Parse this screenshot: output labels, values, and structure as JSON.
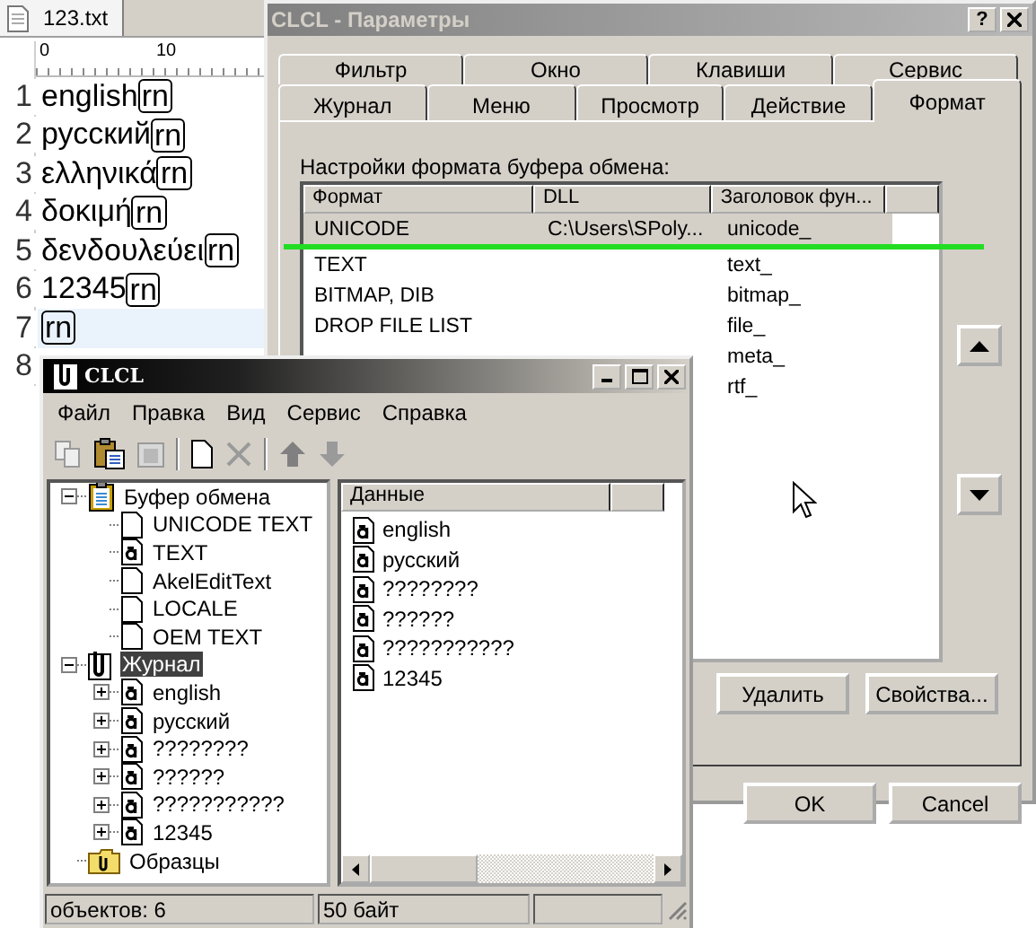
{
  "editor": {
    "tab": "123.txt",
    "ruler": [
      "0",
      "10"
    ],
    "lines": [
      {
        "number": "1",
        "text": "english",
        "eol": "rn",
        "current": false
      },
      {
        "number": "2",
        "text": "русский",
        "eol": "rn",
        "current": false
      },
      {
        "number": "3",
        "text": "ελληνικά",
        "eol": "rn",
        "current": false
      },
      {
        "number": "4",
        "text": "δοκιμή",
        "eol": "rn",
        "current": false
      },
      {
        "number": "5",
        "text": "δενδουλεύει",
        "eol": "rn",
        "current": false
      },
      {
        "number": "6",
        "text": "12345",
        "eol": "rn",
        "current": false
      },
      {
        "number": "7",
        "eol": "rn",
        "current": true
      },
      {
        "number": "8",
        "current": false
      }
    ]
  },
  "options_dialog": {
    "title": "CLCL - Параметры",
    "help_button": "?",
    "tabs_back": [
      {
        "label": "Фильтр",
        "selected": false
      },
      {
        "label": "Окно",
        "selected": false
      },
      {
        "label": "Клавиши",
        "selected": false
      },
      {
        "label": "Сервис",
        "selected": false
      }
    ],
    "tabs_front": [
      {
        "label": "Журнал",
        "selected": false
      },
      {
        "label": "Меню",
        "selected": false
      },
      {
        "label": "Просмотр",
        "selected": false
      },
      {
        "label": "Действие",
        "selected": false
      },
      {
        "label": "Формат",
        "selected": true
      }
    ],
    "section_label": "Настройки формата буфера обмена:",
    "columns": [
      "Формат",
      "DLL",
      "Заголовок фун..."
    ],
    "rows": [
      {
        "format": "UNICODE",
        "dll": "C:\\Users\\SPoly...",
        "header": "unicode_",
        "selected": true
      },
      {
        "format": "TEXT",
        "header": "text_",
        "selected": false
      },
      {
        "format": "BITMAP, DIB",
        "header": "bitmap_",
        "selected": false
      },
      {
        "format": "DROP FILE LIST",
        "header": "file_",
        "selected": false
      },
      {
        "header": "meta_",
        "selected": false
      },
      {
        "header": "rtf_",
        "selected": false
      }
    ],
    "buttons": [
      "Удалить",
      "Свойства..."
    ],
    "dialog_buttons": [
      "OK",
      "Cancel"
    ]
  },
  "clcl": {
    "title": "CLCL",
    "menu": [
      "Файл",
      "Правка",
      "Вид",
      "Сервис",
      "Справка"
    ],
    "toolbar": [
      {
        "kind": "copy",
        "disabled": true
      },
      {
        "kind": "paste",
        "disabled": false
      },
      {
        "kind": "clear",
        "disabled": true
      },
      {
        "kind": "separator"
      },
      {
        "kind": "new",
        "disabled": false
      },
      {
        "kind": "delete",
        "disabled": true
      },
      {
        "kind": "separator"
      },
      {
        "kind": "up",
        "disabled": false
      },
      {
        "kind": "down",
        "disabled": true
      }
    ],
    "tree": [
      {
        "label": "Буфер обмена",
        "kind": "clipboard",
        "expanded": true,
        "selected": false,
        "children": [
          {
            "label": "UNICODE TEXT",
            "kind": "blank",
            "selected": false
          },
          {
            "label": "TEXT",
            "kind": "text",
            "selected": false
          },
          {
            "label": "AkelEditText",
            "kind": "blank",
            "selected": false
          },
          {
            "label": "LOCALE",
            "kind": "blank",
            "selected": false
          },
          {
            "label": "OEM TEXT",
            "kind": "blank",
            "selected": false
          }
        ]
      },
      {
        "label": "Журнал",
        "kind": "history",
        "expanded": true,
        "selected": true,
        "children": [
          {
            "label": "english",
            "kind": "text",
            "expanded": false,
            "selected": false
          },
          {
            "label": "русский",
            "kind": "text",
            "expanded": false,
            "selected": false
          },
          {
            "label": "????????",
            "kind": "text",
            "expanded": false,
            "selected": false
          },
          {
            "label": "??????",
            "kind": "text",
            "expanded": false,
            "selected": false
          },
          {
            "label": "???????????",
            "kind": "text",
            "expanded": false,
            "selected": false
          },
          {
            "label": "12345",
            "kind": "text",
            "expanded": false,
            "selected": false
          }
        ]
      },
      {
        "label": "Образцы",
        "kind": "folder",
        "selected": false
      }
    ],
    "list_columns": [
      "Данные"
    ],
    "list_items": [
      "english",
      "русский",
      "????????",
      "??????",
      "???????????",
      "12345"
    ],
    "status": [
      "объектов: 6",
      "50 байт"
    ]
  }
}
